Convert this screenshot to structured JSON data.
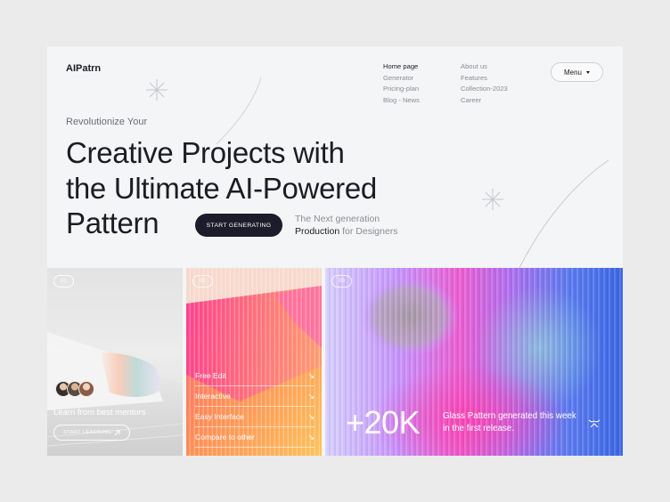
{
  "brand": {
    "logo": "AIPatrn"
  },
  "nav": {
    "col_a": [
      {
        "label": "Home page",
        "active": true
      },
      {
        "label": "Generator",
        "active": false
      },
      {
        "label": "Pricing-plan",
        "active": false
      },
      {
        "label": "Blog - News",
        "active": false
      }
    ],
    "col_b": [
      {
        "label": "About us"
      },
      {
        "label": "Features"
      },
      {
        "label": "Collection-2023"
      },
      {
        "label": "Career"
      }
    ],
    "menu_label": "Menu"
  },
  "hero": {
    "kicker": "Revolutionize Your",
    "headline_1": "Creative Projects with",
    "headline_2": "the Ultimate AI-Powered",
    "headline_3": "Pattern",
    "cta_label": "START GENERATING",
    "sub_1": "The Next generation",
    "sub_2_strong": "Production",
    "sub_2_rest": " for Designers"
  },
  "cards": {
    "mentors": {
      "number": "01",
      "title": "Learn from best mentors",
      "button_label": "START LEARNING"
    },
    "features": {
      "number": "02",
      "items": [
        {
          "label": "Free Edit"
        },
        {
          "label": "Interactive"
        },
        {
          "label": "Easy Interface"
        },
        {
          "label": "Compare to other"
        }
      ]
    },
    "stats": {
      "number": "03",
      "value": "+20K",
      "description": "Glass Pattern generated this week in the first release."
    }
  },
  "colors": {
    "accent_dark": "#1c1c2b",
    "background": "#f4f5f6",
    "card2_orange": "#ff9a58"
  },
  "icons": {
    "sparkle": "sparkle-icon",
    "arrow": "arrow-down-right-icon",
    "bird": "bird-icon"
  }
}
